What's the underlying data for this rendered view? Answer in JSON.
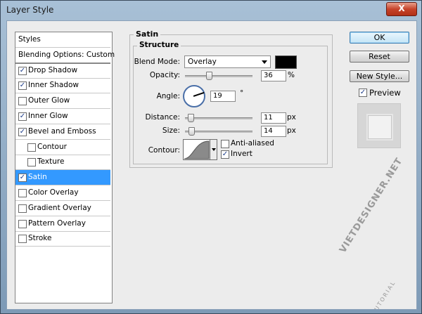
{
  "window": {
    "title": "Layer Style",
    "close_label": "X"
  },
  "styles_list": {
    "items": [
      {
        "label": "Styles",
        "checked": null,
        "kind": "plain"
      },
      {
        "label": "Blending Options: Custom",
        "checked": null,
        "kind": "head"
      },
      {
        "label": "Drop Shadow",
        "checked": true,
        "kind": "item"
      },
      {
        "label": "Inner Shadow",
        "checked": true,
        "kind": "item"
      },
      {
        "label": "Outer Glow",
        "checked": false,
        "kind": "item"
      },
      {
        "label": "Inner Glow",
        "checked": true,
        "kind": "item"
      },
      {
        "label": "Bevel and Emboss",
        "checked": true,
        "kind": "item"
      },
      {
        "label": "Contour",
        "checked": false,
        "kind": "sub"
      },
      {
        "label": "Texture",
        "checked": false,
        "kind": "sub"
      },
      {
        "label": "Satin",
        "checked": true,
        "kind": "selected"
      },
      {
        "label": "Color Overlay",
        "checked": false,
        "kind": "item"
      },
      {
        "label": "Gradient Overlay",
        "checked": false,
        "kind": "item"
      },
      {
        "label": "Pattern Overlay",
        "checked": false,
        "kind": "item"
      },
      {
        "label": "Stroke",
        "checked": false,
        "kind": "item"
      }
    ]
  },
  "panel": {
    "title": "Satin",
    "structure_title": "Structure",
    "blend_mode": {
      "label": "Blend Mode:",
      "value": "Overlay",
      "color": "#000000"
    },
    "opacity": {
      "label": "Opacity:",
      "value": "36",
      "unit": "%",
      "level": 0.36
    },
    "angle": {
      "label": "Angle:",
      "value": "19",
      "unit": "°"
    },
    "distance": {
      "label": "Distance:",
      "value": "11",
      "unit": "px",
      "level": 0.04
    },
    "size": {
      "label": "Size:",
      "value": "14",
      "unit": "px",
      "level": 0.05
    },
    "contour": {
      "label": "Contour:"
    },
    "anti_aliased": {
      "label": "Anti-aliased",
      "checked": false
    },
    "invert": {
      "label": "Invert",
      "checked": true
    }
  },
  "buttons": {
    "ok": "OK",
    "reset": "Reset",
    "new_style": "New Style...",
    "preview_label": "Preview",
    "preview_checked": true
  },
  "watermark": {
    "main": "VIETDESIGNER.NET",
    "sub": "TUTORIAL"
  }
}
